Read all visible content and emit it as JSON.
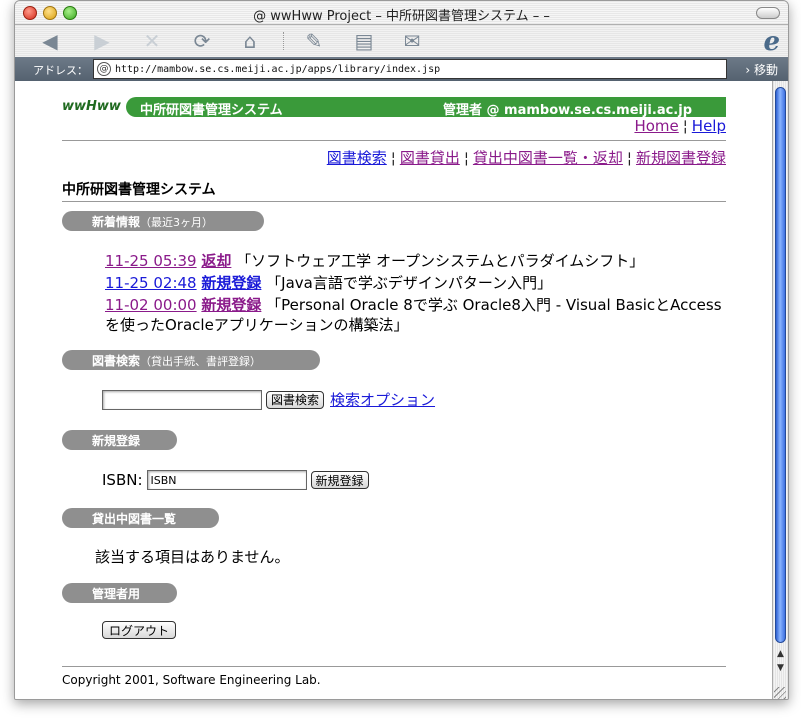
{
  "window": {
    "title": "@ wwHww Project – 中所研図書管理システム  –  –"
  },
  "toolbar": {
    "icons": [
      "back-icon",
      "forward-icon",
      "stop-icon",
      "refresh-icon",
      "home-icon",
      "autofill-icon",
      "print-icon",
      "mail-icon"
    ]
  },
  "address": {
    "label": "アドレス：",
    "url": "http://mambow.se.cs.meiji.ac.jp/apps/library/index.jsp",
    "go_label": "› 移動"
  },
  "header": {
    "brand": "wwHww",
    "system_name": "中所研図書管理システム",
    "admin": "管理者 @ mambow.se.cs.meiji.ac.jp"
  },
  "toplinks": {
    "home": "Home",
    "help": "Help",
    "separator": "¦"
  },
  "nav": {
    "search": "図書検索",
    "lend": "図書貸出",
    "lent_list": "貸出中図書一覧・返却",
    "register": "新規図書登録",
    "separator": "¦"
  },
  "page_title": "中所研図書管理システム",
  "sections": {
    "news": {
      "title": "新着情報",
      "sub": "（最近3ヶ月）"
    },
    "search": {
      "title": "図書検索",
      "sub": "（貸出手続、書評登録）"
    },
    "register": {
      "title": "新規登録"
    },
    "lent": {
      "title": "貸出中図書一覧"
    },
    "admin": {
      "title": "管理者用"
    }
  },
  "news_items": [
    {
      "datetime": "11-25 05:39",
      "tag": "返却",
      "text": "「ソフトウェア工学 オープンシステムとパラダイムシフト」"
    },
    {
      "datetime": "11-25 02:48",
      "tag": "新規登録",
      "text": "「Java言語で学ぶデザインパターン入門」"
    },
    {
      "datetime": "11-02 00:00",
      "tag": "新規登録",
      "text": "「Personal Oracle 8で学ぶ Oracle8入門 - Visual BasicとAccessを使ったOracleアプリケーションの構築法」"
    }
  ],
  "search": {
    "value": "",
    "button": "図書検索",
    "option_link": "検索オプション"
  },
  "register": {
    "label": "ISBN:",
    "value": "ISBN",
    "button": "新規登録"
  },
  "lent": {
    "empty": "該当する項目はありません。"
  },
  "admin": {
    "logout": "ログアウト"
  },
  "footer": {
    "copyright": "Copyright 2001, Software Engineering Lab."
  }
}
